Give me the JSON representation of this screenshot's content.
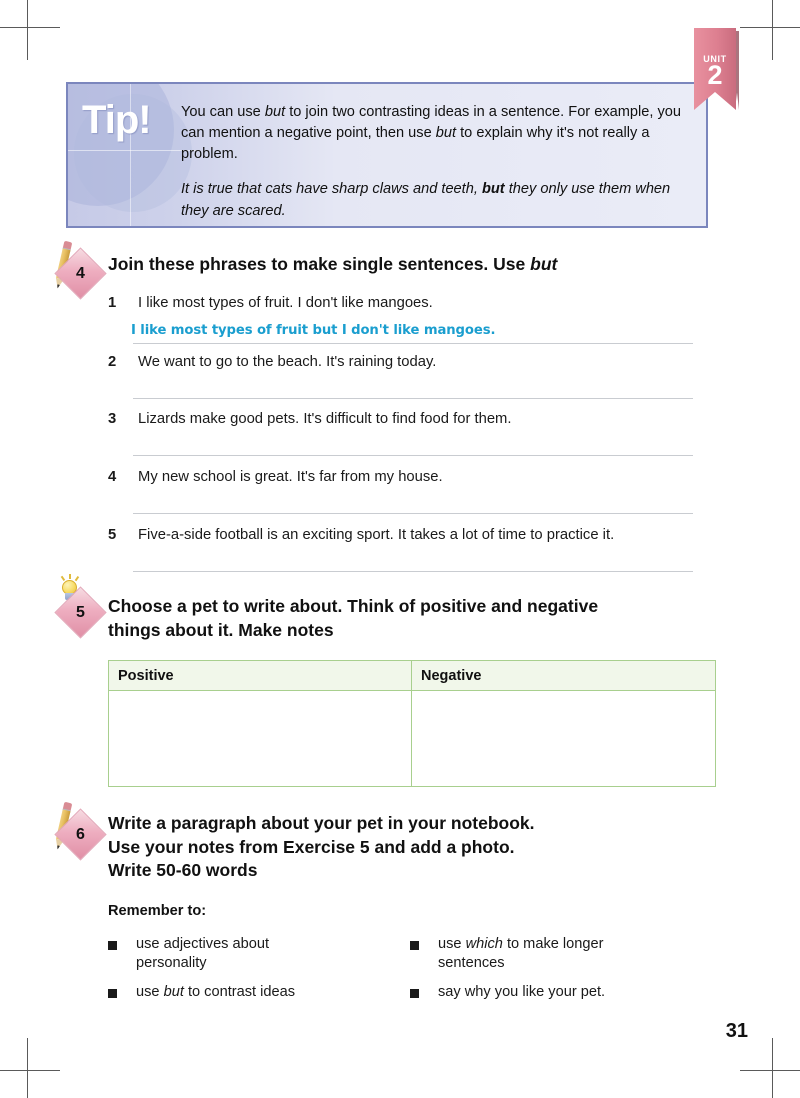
{
  "page": {
    "number": "31",
    "unit_badge": {
      "label": "UNIT",
      "number": "2",
      "color": "#dd7f90"
    }
  },
  "tip": {
    "heading": "Tip!",
    "paragraph": "You can use but to join two contrasting ideas in a sentence. For example, you can mention a negative point, then use but to explain why it's not really a problem.",
    "paragraph_parts": {
      "a": "You can use ",
      "but1": "but",
      "b": " to join two contrasting ideas in a sentence. For example, you can mention a negative point, then use ",
      "but2": "but",
      "c": " to explain why it's not really a problem."
    },
    "example_parts": {
      "a": "It is true that cats have sharp claws and teeth, ",
      "but": "but",
      "b": " they only use them when they are scared."
    },
    "border_color": "#7b86bd",
    "background_color": "#e5e7f4"
  },
  "exercise4": {
    "number": "4",
    "icon": "pencil-icon",
    "heading_parts": {
      "a": "Join these phrases to make single sentences. Use ",
      "italic": "but"
    },
    "items": [
      {
        "number": "1",
        "text": "I like most types of fruit. I don't like mangoes.",
        "answer": "I like most types of fruit but I don't like mangoes."
      },
      {
        "number": "2",
        "text": "We want to go to the beach. It's raining today.",
        "answer": ""
      },
      {
        "number": "3",
        "text": "Lizards make good pets. It's difficult to find food for them.",
        "answer": ""
      },
      {
        "number": "4",
        "text": "My new school is great. It's far from my house.",
        "answer": ""
      },
      {
        "number": "5",
        "text": "Five-a-side football is an exciting sport. It takes a lot of time to practice it.",
        "answer": ""
      }
    ],
    "answer_ink_color": "#1a9ecf"
  },
  "exercise5": {
    "number": "5",
    "icon": "lightbulb-icon",
    "heading_line1": "Choose a pet to write about. Think of positive and negative",
    "heading_line2": "things about it. Make notes",
    "table": {
      "columns": [
        "Positive",
        "Negative"
      ],
      "rows": [
        [
          "",
          ""
        ]
      ],
      "border_color": "#a8cf8e",
      "header_background": "#f1f7ea"
    }
  },
  "exercise6": {
    "number": "6",
    "icon": "pencil-icon",
    "heading_line1": "Write a paragraph about your pet in your notebook.",
    "heading_line2": "Use your notes from Exercise 5 and add a photo.",
    "heading_line3": "Write 50-60 words",
    "remember_title": "Remember to:",
    "bullets_left": [
      {
        "a": "use adjectives about personality",
        "italic": "",
        "b": ""
      },
      {
        "a": "use ",
        "italic": "but",
        "b": " to contrast ideas"
      }
    ],
    "bullets_right": [
      {
        "a": "use ",
        "italic": "which",
        "b": " to make longer sentences"
      },
      {
        "a": "say why you like your pet.",
        "italic": "",
        "b": ""
      }
    ]
  }
}
